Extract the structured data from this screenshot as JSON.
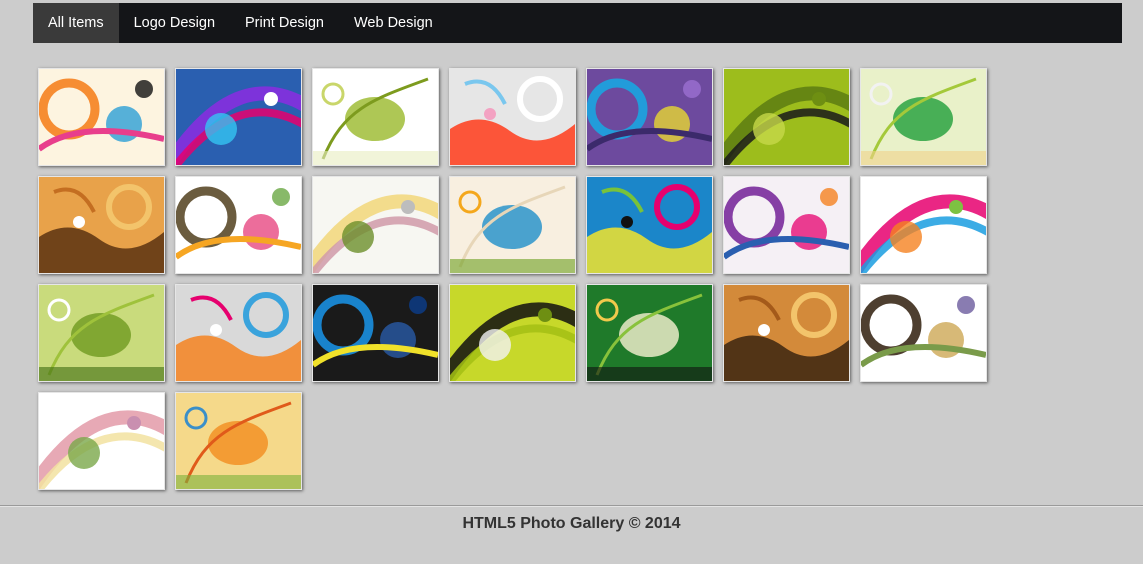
{
  "nav": {
    "items": [
      {
        "label": "All Items",
        "active": true
      },
      {
        "label": "Logo Design",
        "active": false
      },
      {
        "label": "Print Design",
        "active": false
      },
      {
        "label": "Web Design",
        "active": false
      }
    ]
  },
  "gallery": {
    "thumbnails": [
      {
        "name": "thumb-circles-lines",
        "bg": "#fdf4e0",
        "colors": [
          "#f58220",
          "#1e9ad6",
          "#e83e8c",
          "#111111"
        ]
      },
      {
        "name": "thumb-swirl-blue",
        "bg": "#2a5fb0",
        "colors": [
          "#8c2be2",
          "#e6006e",
          "#35c4f2",
          "#ffffff"
        ]
      },
      {
        "name": "thumb-green-floral",
        "bg": "#ffffff",
        "colors": [
          "#9ab92b",
          "#c9d66a",
          "#7d9b1e",
          "#e8ecc0"
        ]
      },
      {
        "name": "thumb-orange-ring",
        "bg": "#e6e6e6",
        "colors": [
          "#ff3b1a",
          "#ffffff",
          "#7ac7ee",
          "#f3a2c2"
        ]
      },
      {
        "name": "thumb-purple-stripes",
        "bg": "#6d4a9e",
        "colors": [
          "#1aa5e0",
          "#f0e12a",
          "#3b2a6b",
          "#9b6fd1"
        ]
      },
      {
        "name": "thumb-green-landscape",
        "bg": "#9dbd1c",
        "colors": [
          "#5d7d12",
          "#1a1a1a",
          "#c7d84a",
          "#6e8f12"
        ]
      },
      {
        "name": "thumb-green-flower",
        "bg": "#e9f1c9",
        "colors": [
          "#1f9f3a",
          "#f2f2f2",
          "#a4c93a",
          "#f0d28a"
        ]
      },
      {
        "name": "thumb-tree-sunset",
        "bg": "#e8a24a",
        "colors": [
          "#5a3310",
          "#f3c46b",
          "#c46e21",
          "#ffffff"
        ]
      },
      {
        "name": "thumb-floral-sketch",
        "bg": "#ffffff",
        "colors": [
          "#5b4a2a",
          "#e63c7a",
          "#f6a623",
          "#6aa843"
        ]
      },
      {
        "name": "thumb-rose-outline",
        "bg": "#f7f7f2",
        "colors": [
          "#f2d77a",
          "#d09aa9",
          "#6b8f2a",
          "#bdbdbd"
        ]
      },
      {
        "name": "thumb-butterfly",
        "bg": "#f8efe0",
        "colors": [
          "#1e8fc9",
          "#f4a71c",
          "#e7d6b8",
          "#6c9e1e"
        ]
      },
      {
        "name": "thumb-tropical-flower",
        "bg": "#1b86c9",
        "colors": [
          "#f2e42b",
          "#e6006e",
          "#78c23b",
          "#111111"
        ]
      },
      {
        "name": "thumb-swirl-purple",
        "bg": "#f5f0f5",
        "colors": [
          "#7a2b9c",
          "#e6006e",
          "#2a5fb0",
          "#f58220"
        ]
      },
      {
        "name": "thumb-paisley",
        "bg": "#ffffff",
        "colors": [
          "#e6006e",
          "#1a9ee0",
          "#f58220",
          "#7dc242"
        ]
      },
      {
        "name": "thumb-green-gears",
        "bg": "#c9db7c",
        "colors": [
          "#6f9a1f",
          "#ffffff",
          "#9fc23b",
          "#3e6b10"
        ]
      },
      {
        "name": "thumb-circles-gray",
        "bg": "#d9d9d9",
        "colors": [
          "#f58220",
          "#3aa3dc",
          "#e6006e",
          "#ffffff"
        ]
      },
      {
        "name": "thumb-blue-arcs",
        "bg": "#1a1a1a",
        "colors": [
          "#1a8fe0",
          "#2a5fb0",
          "#f0e12a",
          "#0b3d8c"
        ]
      },
      {
        "name": "thumb-city-silhouette",
        "bg": "#c7d82a",
        "colors": [
          "#111111",
          "#a3bf14",
          "#f2f2f2",
          "#6e8f12"
        ]
      },
      {
        "name": "thumb-frangipani",
        "bg": "#1f7a2a",
        "colors": [
          "#f7f2d2",
          "#f2c94c",
          "#88c23b",
          "#111111"
        ]
      },
      {
        "name": "thumb-tree-grunge",
        "bg": "#d38a3a",
        "colors": [
          "#3b2410",
          "#f3c46b",
          "#a45a1a",
          "#ffffff"
        ]
      },
      {
        "name": "thumb-leaf-swirls",
        "bg": "#ffffff",
        "colors": [
          "#3b2a1a",
          "#c9a14a",
          "#7a9b4a",
          "#6c5b9e"
        ]
      },
      {
        "name": "thumb-pink-roses",
        "bg": "#ffffff",
        "colors": [
          "#e39aa8",
          "#f2e2a0",
          "#7aa84a",
          "#c98fb0"
        ]
      },
      {
        "name": "thumb-orange-leaves",
        "bg": "#f5d98a",
        "colors": [
          "#f28c1e",
          "#3a8fc9",
          "#e05a1a",
          "#7bb03a"
        ]
      }
    ]
  },
  "footer": {
    "text": "HTML5 Photo Gallery © 2014"
  }
}
